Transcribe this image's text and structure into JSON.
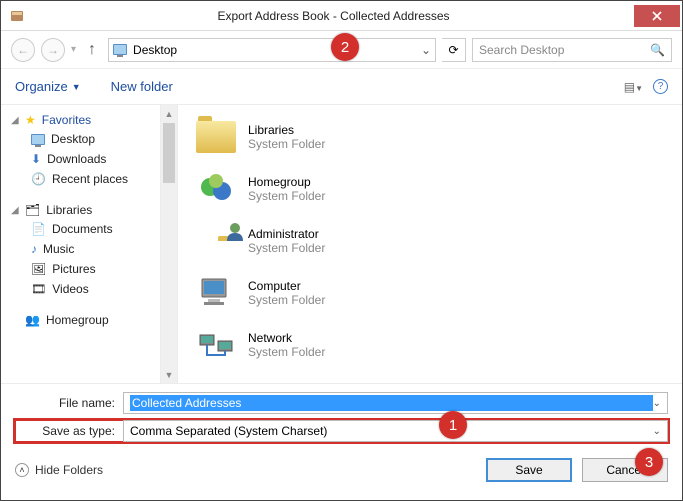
{
  "window": {
    "title": "Export Address Book - Collected Addresses"
  },
  "nav": {
    "location": "Desktop",
    "search_placeholder": "Search Desktop"
  },
  "toolbar": {
    "organize": "Organize",
    "new_folder": "New folder"
  },
  "sidebar": {
    "favorites": {
      "label": "Favorites",
      "items": [
        {
          "label": "Desktop"
        },
        {
          "label": "Downloads"
        },
        {
          "label": "Recent places"
        }
      ]
    },
    "libraries": {
      "label": "Libraries",
      "items": [
        {
          "label": "Documents"
        },
        {
          "label": "Music"
        },
        {
          "label": "Pictures"
        },
        {
          "label": "Videos"
        }
      ]
    },
    "homegroup": {
      "label": "Homegroup"
    }
  },
  "main_items": [
    {
      "name": "Libraries",
      "sub": "System Folder"
    },
    {
      "name": "Homegroup",
      "sub": "System Folder"
    },
    {
      "name": "Administrator",
      "sub": "System Folder"
    },
    {
      "name": "Computer",
      "sub": "System Folder"
    },
    {
      "name": "Network",
      "sub": "System Folder"
    }
  ],
  "form": {
    "file_name_label": "File name:",
    "file_name_value": "Collected Addresses",
    "save_type_label": "Save as type:",
    "save_type_value": "Comma Separated (System Charset)"
  },
  "footer": {
    "hide_folders": "Hide Folders",
    "save": "Save",
    "cancel": "Cancel"
  },
  "callouts": {
    "c1": "1",
    "c2": "2",
    "c3": "3"
  }
}
